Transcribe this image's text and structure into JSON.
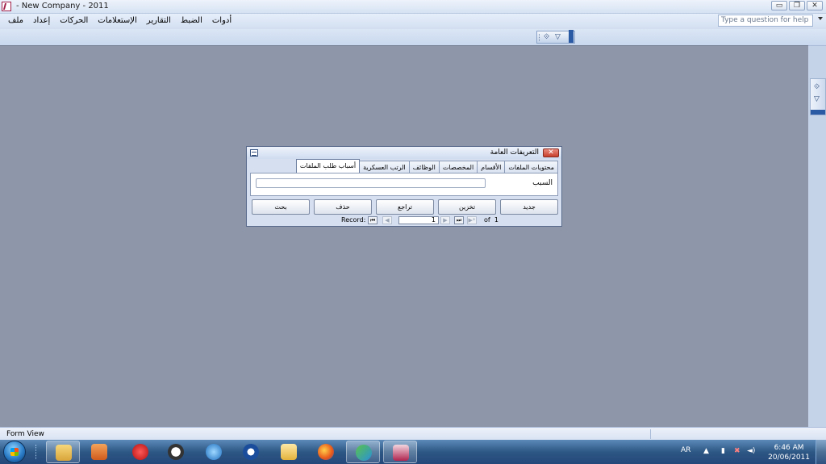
{
  "window": {
    "title": "- New Company - 2011",
    "minimize": "▭",
    "restore": "❐",
    "close": "✕"
  },
  "menu": {
    "items": [
      "ملف",
      "إعداد",
      "الحركات",
      "الإستعلامات",
      "التقارير",
      "الضبط",
      "أدوات"
    ]
  },
  "help": {
    "placeholder": "Type a question for help"
  },
  "status": {
    "text": "Form View"
  },
  "dialog": {
    "title": "التعريفات العامة",
    "close": "✕",
    "tabs": [
      "محتويات الملفات",
      "الأقسام",
      "المخصصات",
      "الوظائف",
      "الرتب العسكرية",
      "أسباب طلب الملفات"
    ],
    "active_tab": 5,
    "field_label": "السبب",
    "field_value": "",
    "buttons": [
      "جديد",
      "تخزين",
      "تراجع",
      "حذف",
      "بحث"
    ],
    "nav": {
      "record_label": "Record:",
      "first": "⏮",
      "prev": "◀",
      "current": "1",
      "next": "▶",
      "last": "⏭",
      "new": "▶*",
      "of_label": "of",
      "total": "1"
    }
  },
  "taskbar": {
    "apps": [
      "folder-icon",
      "media-player-icon",
      "pin-icon",
      "clock-app-icon",
      "internet-explorer-icon",
      "user-icon",
      "mail-icon",
      "firefox-icon",
      "messenger-icon",
      "access-icon"
    ],
    "language": "AR",
    "time": "6:46 AM",
    "date": "20/06/2011"
  }
}
